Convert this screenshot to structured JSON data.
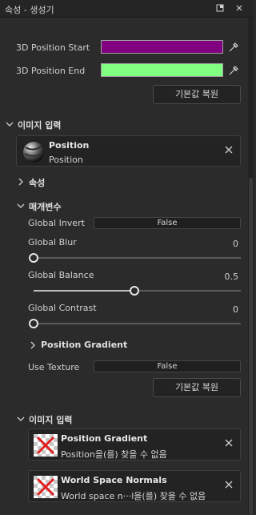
{
  "window": {
    "title": "속성 - 생성기"
  },
  "colors": {
    "start_swatch": "#800080",
    "end_swatch": "#80ff80"
  },
  "position_start": {
    "label": "3D Position Start"
  },
  "position_end": {
    "label": "3D Position End"
  },
  "reset_button_1": "기본값 복원",
  "image_input_1": {
    "section": "이미지 입력",
    "card": {
      "name": "Position",
      "sub": "Position"
    }
  },
  "properties_section": "속성",
  "params": {
    "section": "매개변수",
    "global_invert": {
      "label": "Global Invert",
      "value": "False"
    },
    "global_blur": {
      "label": "Global Blur",
      "value": "0",
      "level": 0.0
    },
    "global_balance": {
      "label": "Global Balance",
      "value": "0.5",
      "level": 0.5
    },
    "global_contrast": {
      "label": "Global Contrast",
      "value": "0",
      "level": 0.0
    },
    "position_gradient": "Position Gradient",
    "use_texture": {
      "label": "Use Texture",
      "value": "False"
    },
    "reset_button": "기본값 복원"
  },
  "image_input_2": {
    "section": "이미지 입력",
    "cards": [
      {
        "name": "Position Gradient",
        "sub": "Position을(를) 찾을 수 없음"
      },
      {
        "name": "World Space Normals",
        "sub": "World space n···l을(를) 찾을 수 없음"
      }
    ]
  }
}
